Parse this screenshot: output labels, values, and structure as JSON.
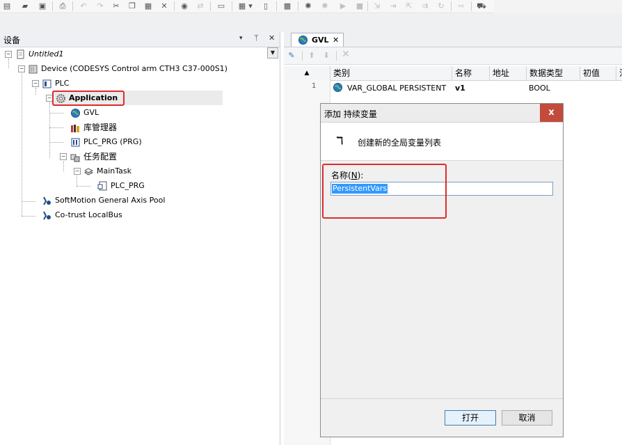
{
  "toolbar": {
    "icons": [
      "new-file-icon",
      "open-folder-icon",
      "save-icon",
      "print-icon",
      "undo-icon",
      "redo-icon",
      "cut-icon",
      "copy-icon",
      "paste-icon",
      "delete-icon",
      "find-icon",
      "replace-icon",
      "window-icon",
      "view-dropdown-icon",
      "page-icon",
      "build-icon",
      "login-icon",
      "logout-icon",
      "run-icon",
      "stop-icon",
      "step-into-icon",
      "step-over-icon",
      "step-out-icon",
      "breakpoint-icon",
      "reset-icon",
      "write-icon",
      "cart-icon"
    ]
  },
  "devices": {
    "title": "设备",
    "pin_glyph": "ᛘ",
    "close_glyph": "✕",
    "menu_glyph": "▾",
    "tree": {
      "project": "Untitled1",
      "device": "Device (CODESYS Control arm CTH3 C37-000S1)",
      "plc": "PLC",
      "application": "Application",
      "gvl": "GVL",
      "library_manager": "库管理器",
      "plc_prg": "PLC_PRG (PRG)",
      "task_config": "任务配置",
      "main_task": "MainTask",
      "main_task_prg": "PLC_PRG",
      "axis_pool": "SoftMotion General Axis Pool",
      "localbus": "Co-trust LocalBus"
    }
  },
  "editor": {
    "tab_label": "GVL",
    "tab_close": "✕",
    "columns": [
      "类别",
      "名称",
      "地址",
      "数据类型",
      "初值",
      "注"
    ],
    "rows": [
      {
        "num": "1",
        "category": "VAR_GLOBAL PERSISTENT",
        "name": "v1",
        "address": "",
        "type": "BOOL",
        "init": ""
      }
    ]
  },
  "dialog": {
    "title": "添加 持续变量",
    "close": "x",
    "header_icon_glyph": "ℸ",
    "header_text": "创建新的全局变量列表",
    "name_label_prefix": "名称(",
    "name_label_key": "N",
    "name_label_suffix": "):",
    "name_value": "PersistentVars",
    "open_label": "打开",
    "cancel_label": "取消"
  },
  "colors": {
    "highlight_box": "#e02a2a",
    "selection": "#3399ff",
    "close_button": "#c24b3b"
  }
}
